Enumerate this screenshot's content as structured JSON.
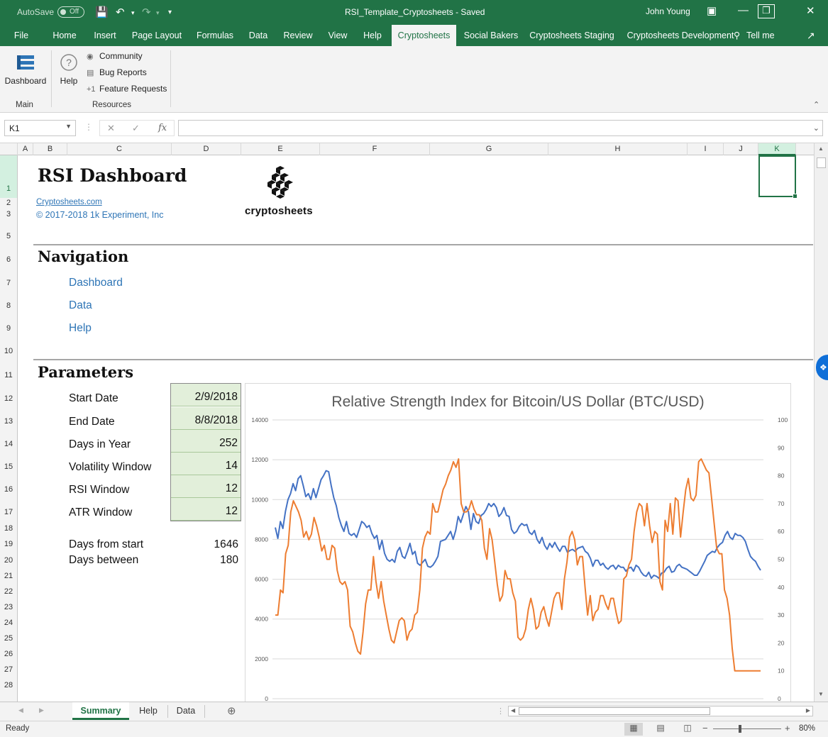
{
  "titlebar": {
    "autosave": "AutoSave",
    "autosave_state": "Off",
    "document_title": "RSI_Template_Cryptosheets  -  Saved",
    "user": "John Young"
  },
  "ribbon_tabs": [
    "File",
    "Home",
    "Insert",
    "Page Layout",
    "Formulas",
    "Data",
    "Review",
    "View",
    "Help",
    "Cryptosheets",
    "Social Bakers",
    "Cryptosheets Staging",
    "Cryptosheets Development"
  ],
  "active_tab": "Cryptosheets",
  "tell_me": "Tell me",
  "ribbon": {
    "dashboard_label": "Dashboard",
    "help_label": "Help",
    "community_label": "Community",
    "bug_reports_label": "Bug Reports",
    "feature_requests_label": "Feature Requests",
    "group_main": "Main",
    "group_resources": "Resources"
  },
  "formula_bar": {
    "name_box": "K1",
    "formula": ""
  },
  "columns": [
    "A",
    "B",
    "C",
    "D",
    "E",
    "F",
    "G",
    "H",
    "I",
    "J",
    "K"
  ],
  "rows": [
    "1",
    "2",
    "3",
    "5",
    "6",
    "7",
    "8",
    "9",
    "10",
    "11",
    "12",
    "13",
    "14",
    "15",
    "16",
    "17",
    "18",
    "19",
    "20",
    "21",
    "22",
    "23",
    "24",
    "25",
    "26",
    "27",
    "28"
  ],
  "sheet": {
    "title": "RSI Dashboard",
    "site_link": "Cryptosheets.com",
    "copyright": "© 2017-2018 1k Experiment, Inc",
    "logo_text": "cryptosheets",
    "navigation_heading": "Navigation",
    "nav_links": [
      "Dashboard",
      "Data",
      "Help"
    ],
    "parameters_heading": "Parameters",
    "parameters": [
      {
        "label": "Start Date",
        "value": "2/9/2018"
      },
      {
        "label": "End Date",
        "value": "8/8/2018"
      },
      {
        "label": "Days in Year",
        "value": "252"
      },
      {
        "label": "Volatility Window",
        "value": "14"
      },
      {
        "label": "RSI Window",
        "value": "12"
      },
      {
        "label": "ATR Window",
        "value": "12"
      }
    ],
    "calculated": [
      {
        "label": "Days from start",
        "value": "1646"
      },
      {
        "label": "Days between",
        "value": "180"
      }
    ]
  },
  "chart_data": {
    "type": "line",
    "title": "Relative Strength Index for Bitcoin/US Dollar (BTC/USD)",
    "xlabel": "",
    "ylabel": "",
    "ylim": [
      0,
      14000
    ],
    "y_ticks": [
      "0",
      "2000",
      "4000",
      "6000",
      "8000",
      "10000",
      "12000",
      "14000"
    ],
    "y2lim": [
      0,
      100
    ],
    "y2_ticks": [
      "0",
      "10",
      "20",
      "30",
      "40",
      "50",
      "60",
      "70",
      "80",
      "90",
      "100"
    ],
    "grid": true,
    "legend": "none",
    "series": [
      {
        "axis": "left",
        "color": "#4472c4",
        "values": [
          8600,
          8050,
          8900,
          8550,
          9400,
          10000,
          10300,
          10800,
          10450,
          11050,
          11200,
          10700,
          10150,
          10300,
          10000,
          10550,
          10100,
          10550,
          11000,
          11200,
          11450,
          11400,
          10700,
          10100,
          9700,
          9100,
          8700,
          8400,
          8900,
          8300,
          8200,
          8300,
          8100,
          8500,
          8900,
          8800,
          8600,
          8700,
          8300,
          8050,
          8200,
          7500,
          7950,
          7300,
          7000,
          6900,
          7000,
          6850,
          7400,
          7600,
          7150,
          7050,
          7400,
          7800,
          7250,
          7400,
          6800,
          6700,
          6850,
          7000,
          6650,
          6600,
          6700,
          6900,
          7150,
          7900,
          7950,
          8000,
          8200,
          8400,
          8000,
          8450,
          9150,
          8850,
          9250,
          9650,
          9400,
          8500,
          9300,
          8900,
          8800,
          9200,
          9300,
          9500,
          9800,
          9650,
          9800,
          9600,
          9150,
          9300,
          9600,
          9200,
          9150,
          8500,
          8300,
          8400,
          8650,
          8800,
          8700,
          8750,
          8350,
          8250,
          8450,
          8000,
          7800,
          8100,
          7700,
          7500,
          7800,
          7600,
          7850,
          7600,
          7400,
          7650,
          7650,
          7350,
          7450,
          7500,
          7400,
          7550,
          7600,
          7650,
          7400,
          7300,
          7050,
          6650,
          6950,
          6950,
          6700,
          6800,
          6600,
          6500,
          6650,
          6700,
          6500,
          6700,
          6600,
          6600,
          6400,
          6550,
          6600,
          6400,
          6700,
          6600,
          6350,
          6200,
          6150,
          6350,
          6050,
          6200,
          6150,
          6050,
          6300,
          6350,
          6550,
          6650,
          6350,
          6400,
          6650,
          6750,
          6600,
          6550,
          6500,
          6400,
          6300,
          6200,
          6200,
          6400,
          6650,
          6900,
          7200,
          7300,
          7400,
          7350,
          7600,
          7750,
          7850,
          8200,
          8400,
          8100,
          8000,
          8300,
          8200,
          8200,
          8100,
          7900,
          7500,
          7150,
          7000,
          6900,
          6650,
          6450
        ]
      },
      {
        "axis": "right",
        "color": "#ed7d31",
        "values": [
          30,
          30,
          39,
          38,
          52,
          55,
          67,
          71,
          69,
          67,
          64,
          58,
          60,
          57,
          59,
          65,
          62,
          58,
          53,
          55,
          50,
          50,
          55,
          54,
          46,
          42,
          41,
          42,
          39,
          26,
          24,
          20,
          17,
          16,
          24,
          34,
          39,
          39,
          51,
          42,
          36,
          42,
          35,
          30,
          25,
          21,
          20,
          24,
          28,
          29,
          28,
          21,
          24,
          25,
          30,
          31,
          39,
          54,
          58,
          60,
          59,
          70,
          67,
          67,
          71,
          75,
          77,
          80,
          82,
          85,
          83,
          86,
          70,
          67,
          67,
          68,
          71,
          68,
          66,
          66,
          64,
          54,
          50,
          61,
          57,
          49,
          41,
          35,
          37,
          46,
          43,
          43,
          38,
          35,
          22,
          21,
          22,
          25,
          32,
          36,
          32,
          25,
          26,
          31,
          33,
          29,
          26,
          31,
          36,
          38,
          38,
          32,
          43,
          49,
          58,
          60,
          57,
          48,
          51,
          51,
          40,
          30,
          37,
          28,
          31,
          32,
          37,
          37,
          34,
          32,
          36,
          36,
          31,
          27,
          28,
          43,
          44,
          48,
          50,
          60,
          67,
          70,
          69,
          62,
          70,
          62,
          56,
          60,
          59,
          42,
          39,
          64,
          60,
          70,
          59,
          72,
          71,
          58,
          67,
          75,
          79,
          72,
          71,
          73,
          85,
          86,
          84,
          82,
          81,
          72,
          63,
          54,
          52,
          52,
          39,
          36,
          30,
          18,
          10,
          10,
          10,
          10,
          10,
          10,
          10,
          10,
          10,
          10,
          10
        ]
      }
    ]
  },
  "sheet_tabs": [
    "Summary",
    "Help",
    "Data"
  ],
  "active_sheet": "Summary",
  "status": {
    "ready": "Ready",
    "zoom": "80%"
  }
}
